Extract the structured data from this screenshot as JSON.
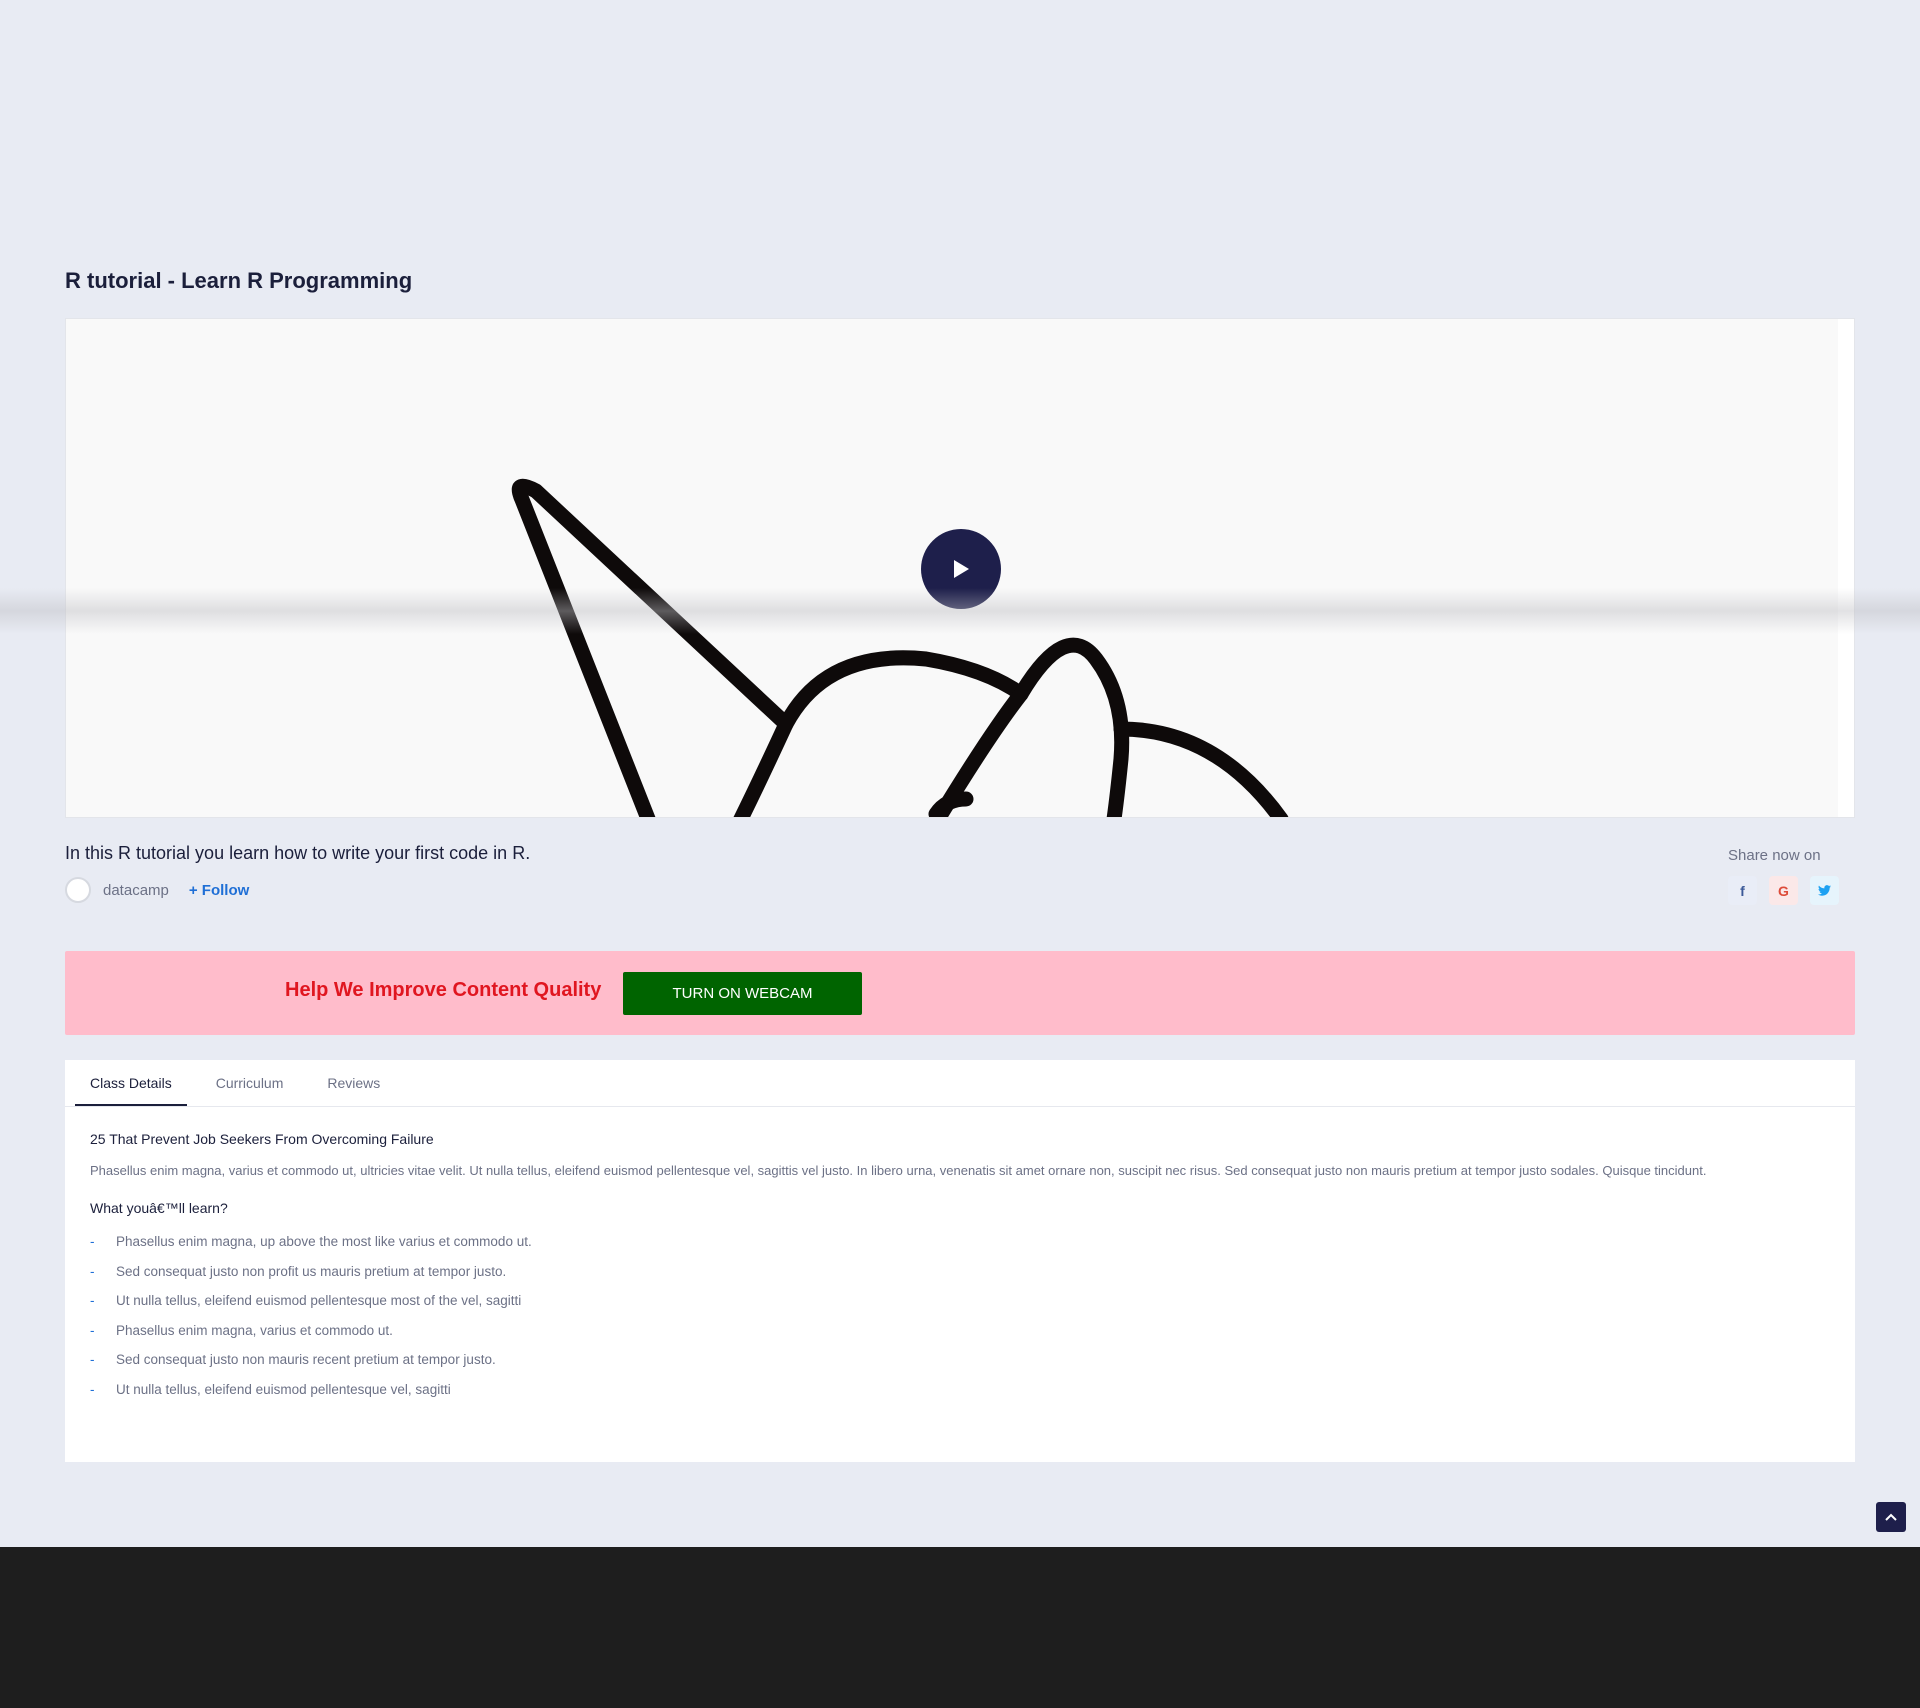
{
  "page": {
    "title": "R tutorial - Learn R Programming",
    "description": "In this R tutorial you learn how to write your first code in R."
  },
  "author": {
    "name": "datacamp",
    "follow_label": "+ Follow"
  },
  "share": {
    "label": "Share now on",
    "icons": [
      "facebook-icon",
      "google-icon",
      "twitter-icon"
    ],
    "facebook_glyph": "f",
    "google_glyph": "G"
  },
  "banner": {
    "text": "Help We Improve Content Quality",
    "button_label": "TURN ON WEBCAM",
    "background": "#ffbccb",
    "text_color": "#e01620",
    "button_color": "#006400"
  },
  "tabs": [
    {
      "label": "Class Details",
      "active": true
    },
    {
      "label": "Curriculum",
      "active": false
    },
    {
      "label": "Reviews",
      "active": false
    }
  ],
  "class_details": {
    "heading": "25 That Prevent Job Seekers From Overcoming Failure",
    "paragraph": "Phasellus enim magna, varius et commodo ut, ultricies vitae velit. Ut nulla tellus, eleifend euismod pellentesque vel, sagittis vel justo. In libero urna, venenatis sit amet ornare non, suscipit nec risus. Sed consequat justo non mauris pretium at tempor justo sodales. Quisque tincidunt.",
    "learn_heading": "What youâ€™ll learn?",
    "bullet": "-",
    "learn_items": [
      "Phasellus enim magna, up above the most like varius et commodo ut.",
      "Sed consequat justo non profit us mauris pretium at tempor justo.",
      "Ut nulla tellus, eleifend euismod pellentesque most of the vel, sagitti",
      "Phasellus enim magna, varius et commodo ut.",
      "Sed consequat justo non mauris recent pretium at tempor justo.",
      "Ut nulla tellus, eleifend euismod pellentesque vel, sagitti"
    ]
  },
  "colors": {
    "page_bg": "#e8ebf3",
    "accent_dark": "#1e1f4b",
    "link_blue": "#1f6fd6",
    "footer_bg": "#1e1e1e"
  }
}
